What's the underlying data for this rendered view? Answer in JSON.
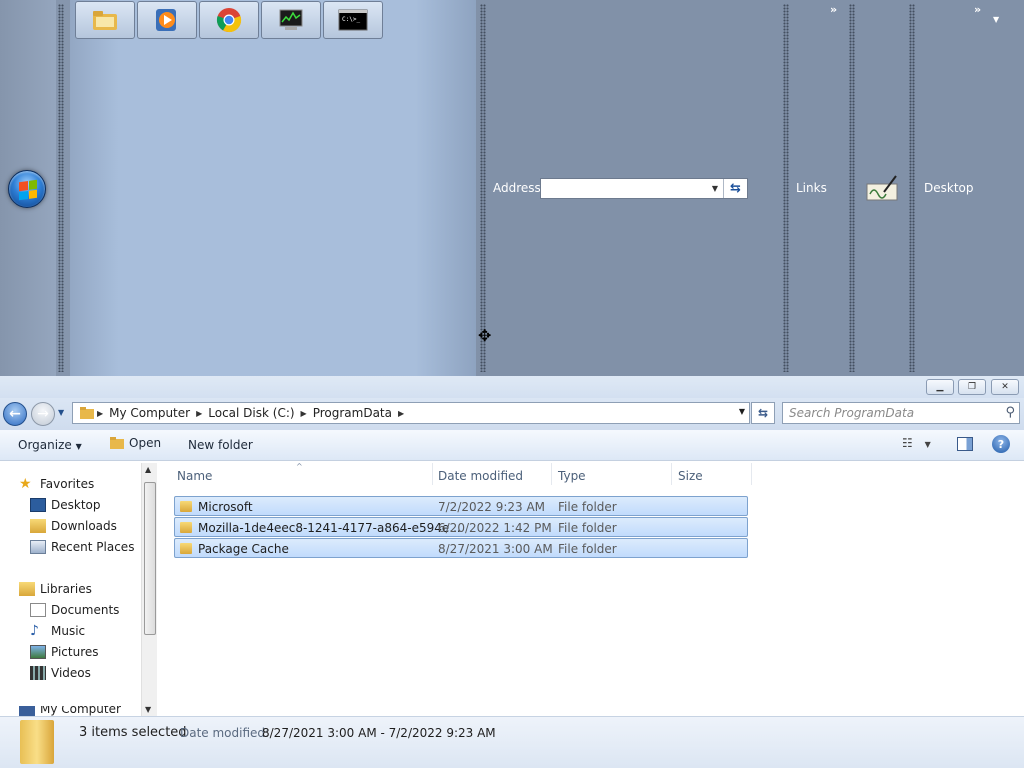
{
  "taskbar": {
    "address_label": "Address",
    "address_value": "",
    "links_label": "Links",
    "desktop_label": "Desktop",
    "chevron": "»",
    "pinned": [
      "file-explorer-icon",
      "media-player-icon",
      "chrome-icon",
      "task-manager-icon",
      "command-prompt-icon"
    ],
    "cmd_text": "C:\\>_"
  },
  "window": {
    "buttons": [
      "minimize",
      "restore",
      "close"
    ]
  },
  "nav": {
    "breadcrumb": [
      "My Computer",
      "Local Disk (C:)",
      "ProgramData"
    ],
    "search_placeholder": "Search ProgramData"
  },
  "commands": {
    "organize": "Organize",
    "open": "Open",
    "new_folder": "New folder"
  },
  "sidebar": {
    "favorites_label": "Favorites",
    "favorites": [
      "Desktop",
      "Downloads",
      "Recent Places"
    ],
    "libraries_label": "Libraries",
    "libraries": [
      "Documents",
      "Music",
      "Pictures",
      "Videos"
    ],
    "computer_label": "My Computer"
  },
  "files": {
    "columns": [
      "Name",
      "Date modified",
      "Type",
      "Size"
    ],
    "rows": [
      {
        "name": "Microsoft",
        "date": "7/2/2022 9:23 AM",
        "type": "File folder",
        "size": ""
      },
      {
        "name": "Mozilla-1de4eec8-1241-4177-a864-e594e...",
        "date": "6/20/2022 1:42 PM",
        "type": "File folder",
        "size": ""
      },
      {
        "name": "Package Cache",
        "date": "8/27/2021 3:00 AM",
        "type": "File folder",
        "size": ""
      }
    ]
  },
  "details": {
    "selected": "3 items selected",
    "date_label": "Date modified:",
    "date_range": "8/27/2021 3:00 AM - 7/2/2022 9:23 AM"
  },
  "colors": {
    "taskbar": "#8191a8",
    "selection": "#c1dbfc",
    "accent": "#2d6bc2"
  }
}
